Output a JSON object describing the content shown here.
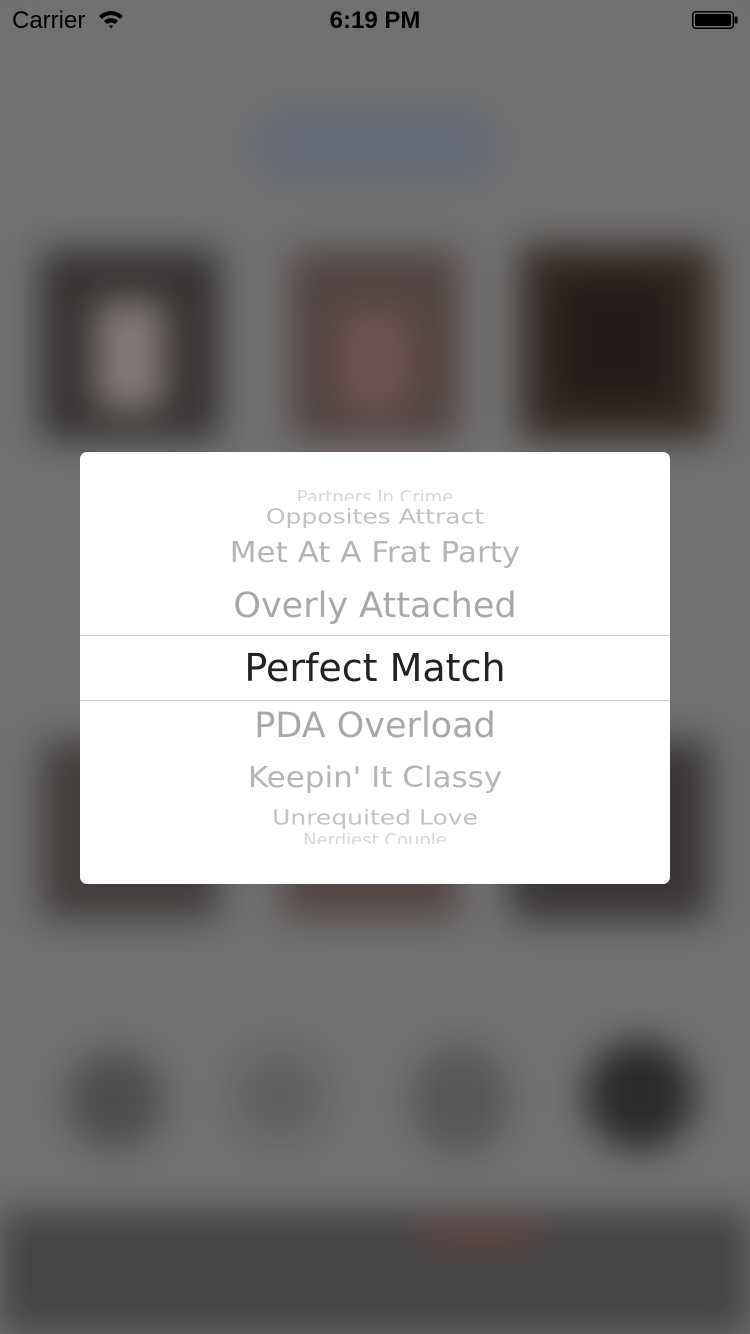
{
  "status_bar": {
    "carrier": "Carrier",
    "time": "6:19 PM",
    "wifi_icon": "wifi-icon",
    "battery_icon": "battery-icon"
  },
  "picker": {
    "selected_index": 4,
    "options": [
      "Partners In Crime",
      "Opposites Attract",
      "Met At A Frat Party",
      "Overly Attached",
      "Perfect Match",
      "PDA Overload",
      "Keepin' It Classy",
      "Unrequited Love",
      "Nerdiest Couple"
    ]
  },
  "colors": {
    "selected_text": "#222222",
    "unselected_text": "#a8a8a8",
    "dialog_background": "#ffffff"
  }
}
